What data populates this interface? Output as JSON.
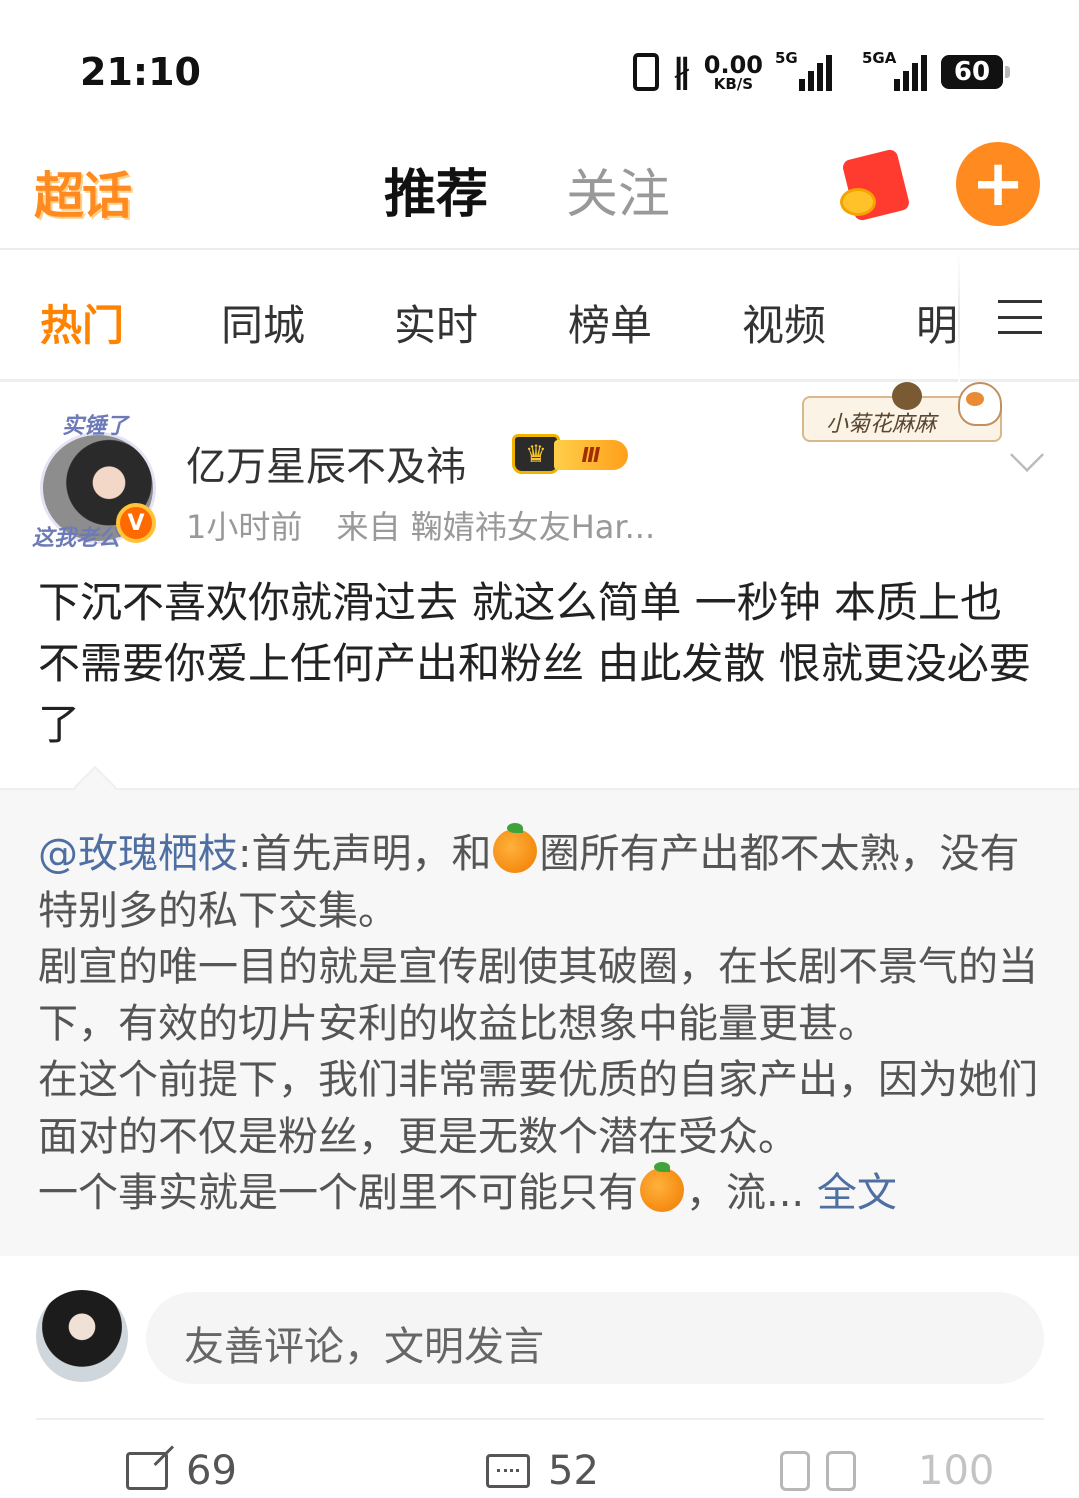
{
  "status_bar": {
    "time": "21:10",
    "net_speed_value": "0.00",
    "net_speed_unit": "KB/S",
    "sim1_label": "5G",
    "sim2_label": "5GA",
    "battery": "60",
    "icons": [
      "vibrate-icon",
      "bluetooth-icon",
      "signal-icon",
      "battery-icon"
    ]
  },
  "header": {
    "logo": "超话",
    "tabs": [
      {
        "label": "推荐",
        "active": true
      },
      {
        "label": "关注",
        "active": false
      }
    ],
    "add_button": "+",
    "accent_color": "#ff8a1f"
  },
  "channels": {
    "items": [
      "热门",
      "同城",
      "实时",
      "榜单",
      "视频",
      "明"
    ],
    "active_index": 0,
    "active_color": "#ff8200"
  },
  "post": {
    "avatar_deco_top": "实锤了",
    "avatar_deco_bottom": "这我老公",
    "verified": "V",
    "username": "亿万星辰不及祎",
    "level": "Ⅲ",
    "time_ago": "1小时前",
    "source": "来自 鞠婧祎女友Har...",
    "decor_tag": "小菊花麻麻",
    "text": "下沉不喜欢你就滑过去 就这么简单 一秒钟  本质上也不需要你爱上任何产出和粉丝  由此发散 恨就更没必要了"
  },
  "quote": {
    "mention": "@玫瑰栖枝",
    "seg1": ":首先声明，和",
    "seg2": "圈所有产出都不太熟，没有特别多的私下交集。",
    "line2": "剧宣的唯一目的就是宣传剧使其破圈，在长剧不景气的当下，有效的切片安利的收益比想象中能量更甚。",
    "line3": "在这个前提下，我们非常需要优质的自家产出，因为她们面对的不仅是粉丝，更是无数个潜在受众。",
    "line4": "一个事实就是一个剧里不可能只有",
    "line4_end": "，流...",
    "more_link": "全文",
    "emoji": "orange-emoji"
  },
  "comment_box": {
    "placeholder": "友善评论，文明发言"
  },
  "actions": {
    "share_count": "69",
    "comment_count": "52",
    "like_count": "100"
  }
}
